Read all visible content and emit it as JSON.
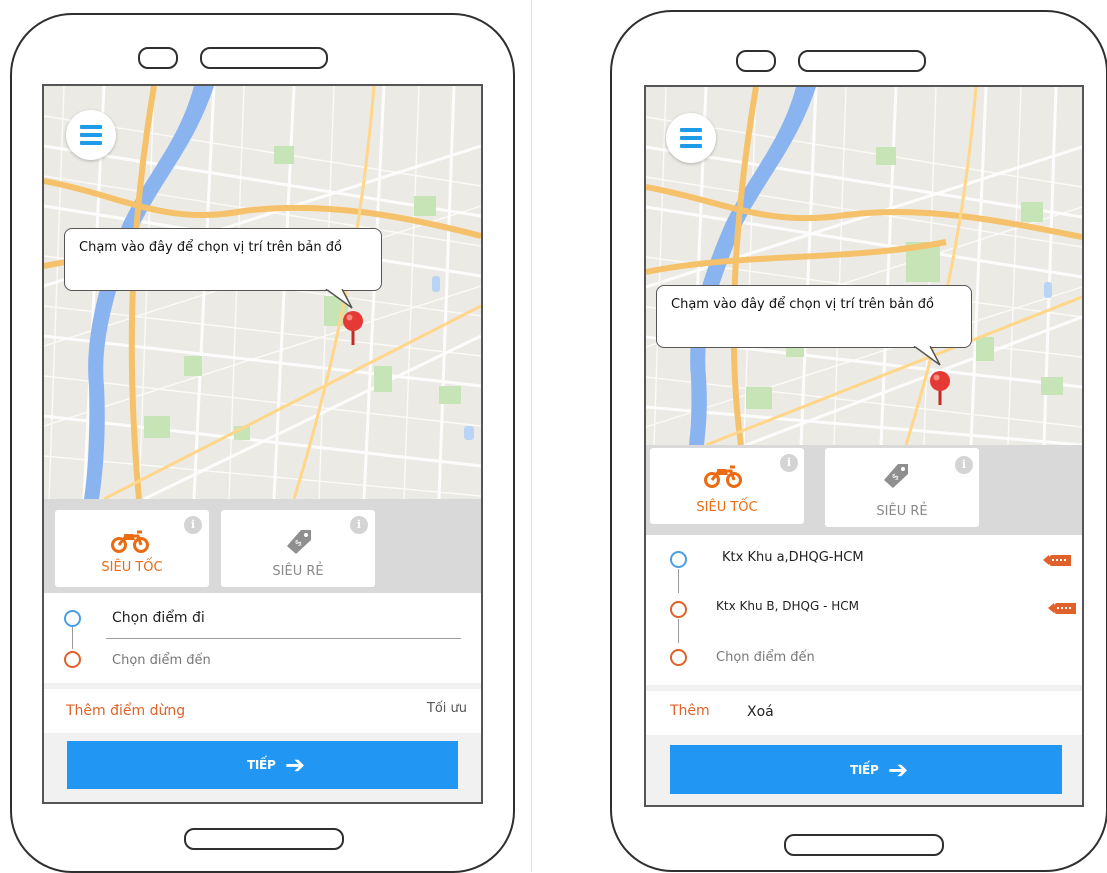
{
  "screens": [
    {
      "map_hint": "Chạm vào đây để chọn vị trí trên bản đồ",
      "services": [
        {
          "label": "SIÊU TỐC",
          "icon": "motorbike-icon",
          "selected": true
        },
        {
          "label": "SIÊU RẺ",
          "icon": "price-tag-icon",
          "selected": false
        }
      ],
      "route": {
        "pickup": "Chọn điểm đi",
        "destination_placeholder": "Chọn điểm đến"
      },
      "add_stop_label": "Thêm điểm dừng",
      "optimize_label": "Tối ưu",
      "next_label": "TIẾP"
    },
    {
      "map_hint": "Chạm vào đây để chọn vị trí trên bản đồ",
      "services": [
        {
          "label": "SIÊU TỐC",
          "icon": "motorbike-icon",
          "selected": true
        },
        {
          "label": "SIÊU RẺ",
          "icon": "price-tag-icon",
          "selected": false
        }
      ],
      "route": {
        "stops": [
          "Ktx Khu a,DHQG-HCM",
          "Ktx Khu B, DHQG - HCM"
        ],
        "destination_placeholder": "Chọn điểm đến"
      },
      "add_label": "Thêm",
      "delete_label": "Xoá",
      "next_label": "TIẾP"
    }
  ],
  "colors": {
    "accent_orange": "#ea6b12",
    "primary_blue": "#2196f3",
    "pin_red": "#e53935",
    "menu_blue": "#1e9be9"
  }
}
